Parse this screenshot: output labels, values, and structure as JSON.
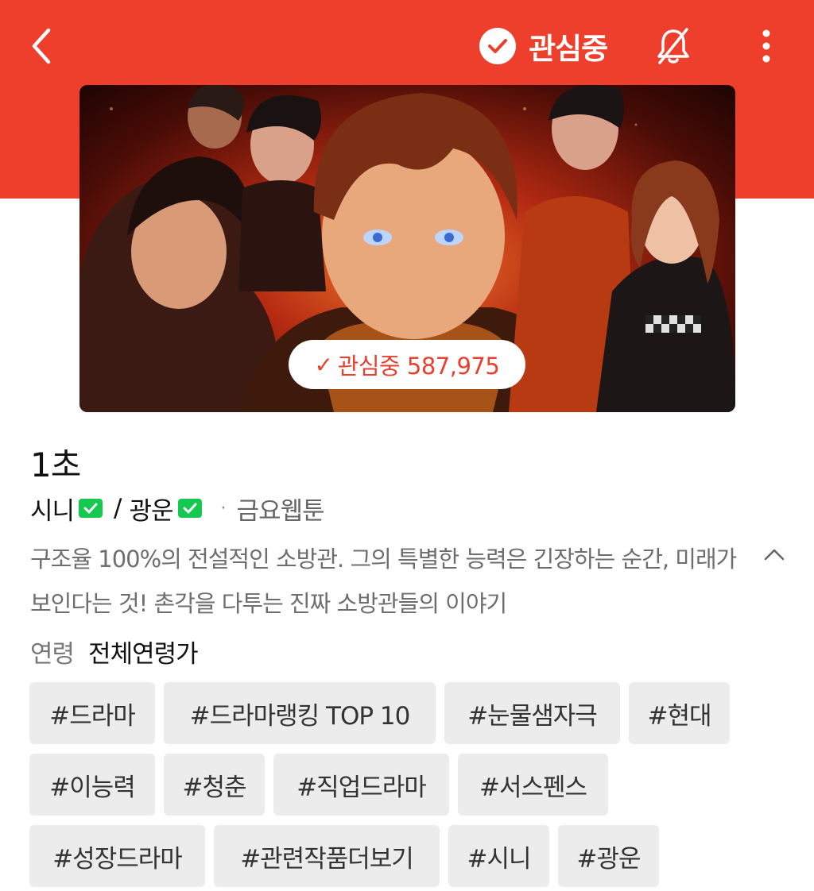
{
  "header": {
    "back_icon": "chevron-left-icon",
    "favorite_label": "관심중",
    "favorite_icon": "check-circle-icon",
    "notify_icon": "bell-off-icon",
    "more_icon": "more-vertical-icon",
    "bg_color": "#ee3f2c"
  },
  "thumbnail": {
    "favorite_count_label": "관심중 587,975"
  },
  "title": "1초",
  "authors": [
    {
      "name": "시니",
      "badge": "verified-icon"
    },
    {
      "name": "광운",
      "badge": "verified-icon"
    }
  ],
  "separator": "/",
  "day_separator": "·",
  "day": "금요웹툰",
  "description": "구조율 100%의 전설적인 소방관. 그의 특별한 능력은 긴장하는 순간, 미래가 보인다는 것! 촌각을 다투는 진짜 소방관들의 이야기",
  "age": {
    "label": "연령",
    "value": "전체연령가"
  },
  "tags": [
    [
      "#드라마",
      "#드라마랭킹 TOP 10",
      "#눈물샘자극",
      "#현대"
    ],
    [
      "#이능력",
      "#청춘",
      "#직업드라마",
      "#서스펜스"
    ],
    [
      "#성장드라마",
      "#관련작품더보기",
      "#시니",
      "#광운"
    ]
  ]
}
